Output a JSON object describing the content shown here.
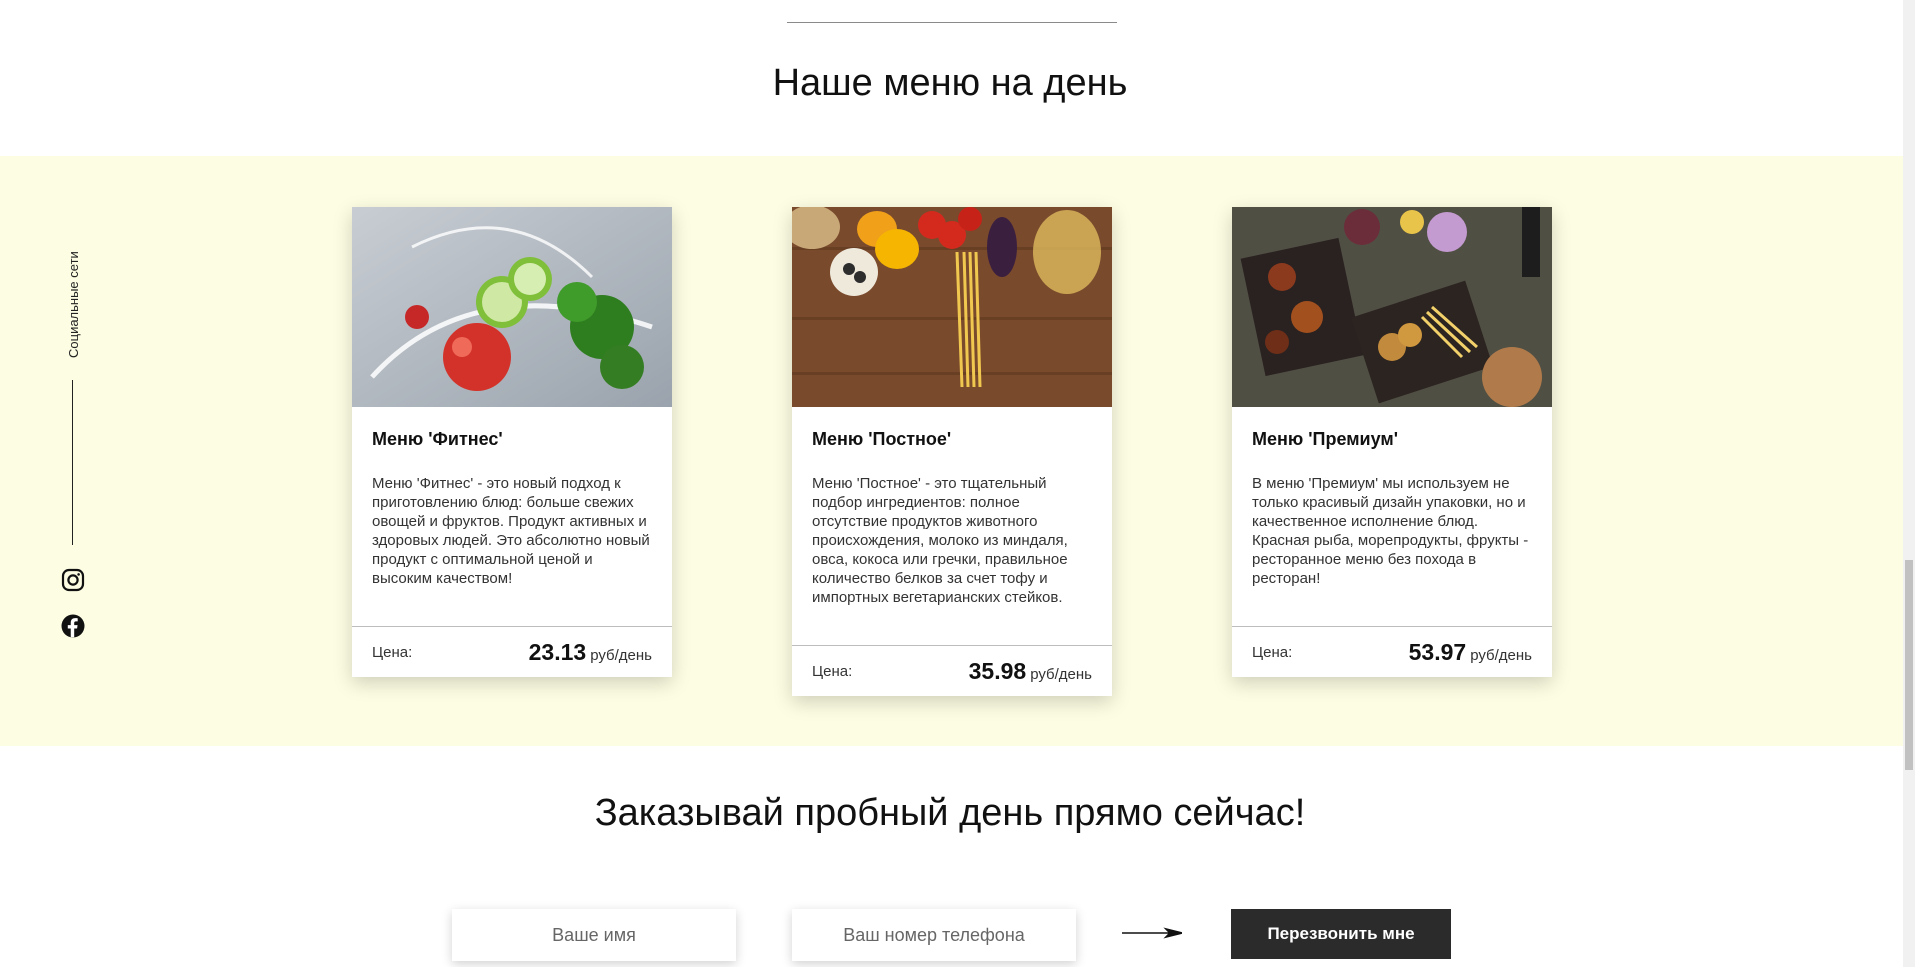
{
  "menu_section": {
    "title": "Наше меню на день"
  },
  "social": {
    "label": "Социальные сети",
    "icons": [
      "instagram-icon",
      "facebook-icon"
    ]
  },
  "cards": [
    {
      "title": "Меню 'Фитнес'",
      "description": "Меню 'Фитнес' - это новый подход к приготовлению блюд: больше свежих овощей и фруктов. Продукт активных и здоровых людей. Это абсолютно новый продукт с оптимальной ценой и высоким качеством!",
      "price_label": "Цена:",
      "price_value": "23.13",
      "price_unit": "руб/день"
    },
    {
      "title": "Меню 'Постное'",
      "description": "Меню 'Постное' - это тщательный подбор ингредиентов: полное отсутствие продуктов животного происхождения, молоко из миндаля, овса, кокоса или гречки, правильное количество белков за счет тофу и импортных вегетарианских стейков.",
      "price_label": "Цена:",
      "price_value": "35.98",
      "price_unit": "руб/день"
    },
    {
      "title": "Меню 'Премиум'",
      "description": "В меню 'Премиум' мы используем не только красивый дизайн упаковки, но и качественное исполнение блюд. Красная рыба, морепродукты, фрукты - ресторанное меню без похода в ресторан!",
      "price_label": "Цена:",
      "price_value": "53.97",
      "price_unit": "руб/день"
    }
  ],
  "order": {
    "title": "Заказывай пробный день прямо сейчас!",
    "name_placeholder": "Ваше имя",
    "phone_placeholder": "Ваш номер телефона",
    "button_label": "Перезвонить мне"
  },
  "colors": {
    "band_background": "#fdfde3",
    "button_background": "#2b2b2b"
  }
}
